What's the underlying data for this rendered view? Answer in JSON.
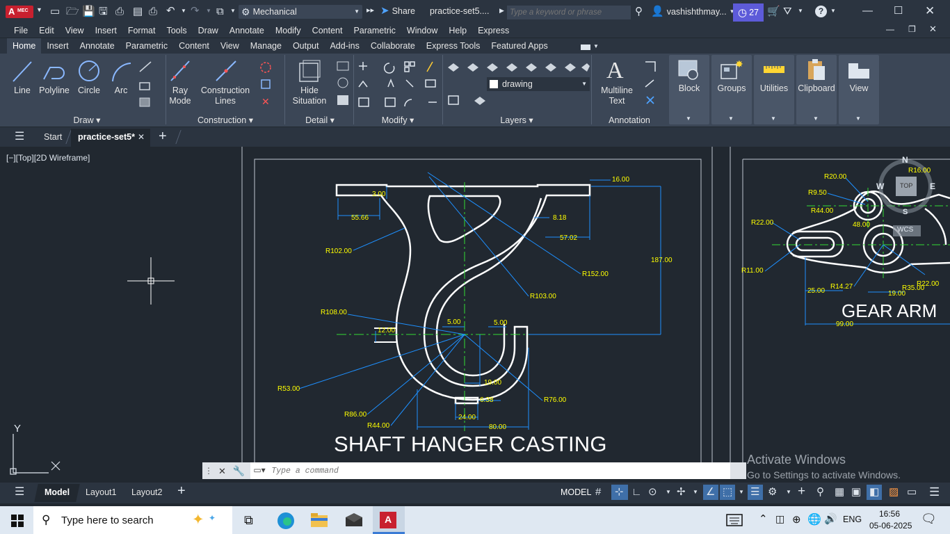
{
  "titlebar": {
    "app_badge": "A",
    "app_badge_sub": "MEC",
    "workspace": "Mechanical",
    "share": "Share",
    "doc_title": "practice-set5....",
    "search_placeholder": "Type a keyword or phrase",
    "user": "vashishthmay...",
    "notif_count": "27"
  },
  "menubar": {
    "items": [
      "File",
      "Edit",
      "View",
      "Insert",
      "Format",
      "Tools",
      "Draw",
      "Annotate",
      "Modify",
      "Content",
      "Parametric",
      "Window",
      "Help",
      "Express"
    ]
  },
  "ribbon_tabs": {
    "items": [
      "Home",
      "Insert",
      "Annotate",
      "Parametric",
      "Content",
      "View",
      "Manage",
      "Output",
      "Add-ins",
      "Collaborate",
      "Express Tools",
      "Featured Apps"
    ],
    "active": "Home"
  },
  "ribbon": {
    "draw": {
      "line": "Line",
      "polyline": "Polyline",
      "circle": "Circle",
      "arc": "Arc",
      "title": "Draw"
    },
    "construction": {
      "ray1": "Ray",
      "ray2": "Mode",
      "cl1": "Construction",
      "cl2": "Lines",
      "title": "Construction"
    },
    "detail": {
      "hs1": "Hide",
      "hs2": "Situation",
      "title": "Detail"
    },
    "modify": {
      "title": "Modify"
    },
    "layers": {
      "current": "drawing",
      "title": "Layers"
    },
    "annotation": {
      "mt1": "Multiline",
      "mt2": "Text",
      "title": "Annotation"
    },
    "block": "Block",
    "groups": "Groups",
    "utilities": "Utilities",
    "clipboard": "Clipboard",
    "view": "View"
  },
  "doctabs": {
    "start": "Start",
    "active": "practice-set5*"
  },
  "viewport": {
    "label": "[−][Top][2D Wireframe]"
  },
  "drawing1": {
    "title": "SHAFT HANGER CASTING",
    "dims": [
      "16.00",
      "3.00",
      "55.66",
      "8.18",
      "57.02",
      "R102.00",
      "187.00",
      "R152.00",
      "R103.00",
      "R108.00",
      "5.00",
      "5.00",
      "12.00",
      "R53.00",
      "19.00",
      "6.38",
      "R76.00",
      "R86.00",
      "R44.00",
      "24.00",
      "80.00"
    ]
  },
  "drawing2": {
    "title": "GEAR ARM",
    "dims": [
      "R20.00",
      "R16.00",
      "R9.50",
      "R44.00",
      "48.00",
      "R22.00",
      "R11.00",
      "25.00",
      "R14.27",
      "19.00",
      "R35.00",
      "R22.00",
      "99.00"
    ]
  },
  "viewcube": {
    "n": "N",
    "s": "S",
    "e": "E",
    "w": "W",
    "top": "TOP",
    "wcs": "WCS"
  },
  "command": {
    "placeholder": "Type a command"
  },
  "watermark": {
    "line1": "Activate Windows",
    "line2": "Go to Settings to activate Windows."
  },
  "statusbar": {
    "model": "Model",
    "layout1": "Layout1",
    "layout2": "Layout2",
    "mode": "MODEL"
  },
  "taskbar": {
    "search": "Type here to search",
    "lang": "ENG",
    "time": "16:56",
    "date": "05-06-2025"
  },
  "ucs": {
    "y": "Y",
    "x": "X"
  }
}
